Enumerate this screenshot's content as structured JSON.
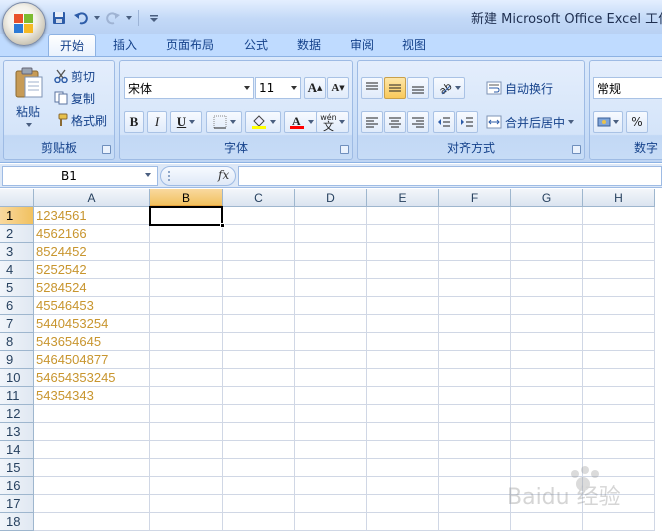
{
  "window": {
    "title": "新建 Microsoft Office Excel 工作表"
  },
  "quick_access": {
    "icons": [
      "save-icon",
      "undo-icon",
      "redo-icon",
      "customize-icon"
    ]
  },
  "tabs": [
    {
      "label": "开始",
      "active": true
    },
    {
      "label": "插入"
    },
    {
      "label": "页面布局"
    },
    {
      "label": "公式"
    },
    {
      "label": "数据"
    },
    {
      "label": "审阅"
    },
    {
      "label": "视图"
    }
  ],
  "ribbon": {
    "clipboard": {
      "label": "剪贴板",
      "paste": "粘贴",
      "cut": "剪切",
      "copy": "复制",
      "format_painter": "格式刷"
    },
    "font": {
      "label": "字体",
      "font_name": "宋体",
      "font_size": "11",
      "bold": "B",
      "italic": "I",
      "underline": "U",
      "grow": "A",
      "shrink": "A",
      "wen": "wén",
      "wen_char": "文",
      "font_color": "#ff0000",
      "fill_color": "#ffff00"
    },
    "alignment": {
      "label": "对齐方式",
      "wrap_text": "自动换行",
      "merge_center": "合并后居中"
    },
    "number": {
      "label": "数字",
      "format": "常规",
      "percent": "%"
    }
  },
  "formula_bar": {
    "name_box": "B1",
    "fx": "fx",
    "formula": ""
  },
  "sheet": {
    "columns": [
      "A",
      "B",
      "C",
      "D",
      "E",
      "F",
      "G",
      "H"
    ],
    "selected_column": "B",
    "selected_row": 1,
    "rows": [
      {
        "num": "1",
        "a": "1234561"
      },
      {
        "num": "2",
        "a": "4562166"
      },
      {
        "num": "3",
        "a": "8524452"
      },
      {
        "num": "4",
        "a": "5252542"
      },
      {
        "num": "5",
        "a": "5284524"
      },
      {
        "num": "6",
        "a": "45546453"
      },
      {
        "num": "7",
        "a": "5440453254"
      },
      {
        "num": "8",
        "a": "543654645"
      },
      {
        "num": "9",
        "a": "5464504877"
      },
      {
        "num": "10",
        "a": "54654353245"
      },
      {
        "num": "11",
        "a": "54354343"
      },
      {
        "num": "12",
        "a": ""
      },
      {
        "num": "13",
        "a": ""
      },
      {
        "num": "14",
        "a": ""
      },
      {
        "num": "15",
        "a": ""
      },
      {
        "num": "16",
        "a": ""
      },
      {
        "num": "17",
        "a": ""
      },
      {
        "num": "18",
        "a": ""
      }
    ],
    "value_color": "#c8952e"
  },
  "watermark": {
    "text": "Baidu 经验"
  }
}
